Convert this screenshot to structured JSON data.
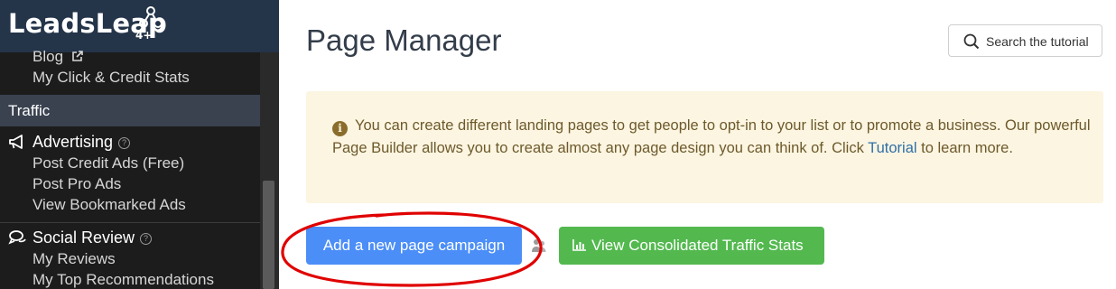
{
  "sidebar": {
    "brand": {
      "name": "LeadsLeap",
      "badge": "4+"
    },
    "top_links": [
      "Blog",
      "My Click & Credit Stats"
    ],
    "section_title": "Traffic",
    "groups": [
      {
        "title": "Advertising",
        "icon": "megaphone-icon",
        "items": [
          "Post Credit Ads (Free)",
          "Post Pro Ads",
          "View Bookmarked Ads"
        ]
      },
      {
        "title": "Social Review",
        "icon": "chat-bubbles-icon",
        "items": [
          "My Reviews",
          "My Top Recommendations"
        ]
      }
    ],
    "help_glyph": "?"
  },
  "main": {
    "title": "Page Manager",
    "tutorial_button": "Search the tutorial",
    "alert": {
      "icon_glyph": "i",
      "text_before": "You can create different landing pages to get people to opt-in to your list or to promote a business. Our powerful Page Builder allows you to create almost any page design you can think of. Click ",
      "link": "Tutorial",
      "text_after": " to learn more."
    },
    "buttons": {
      "add_campaign": "Add a new page campaign",
      "view_stats": "View Consolidated Traffic Stats"
    }
  },
  "colors": {
    "sidebar_bg": "#1c1c1c",
    "brand_bg": "#243449",
    "section_bg": "#3a4250",
    "primary_button": "#4b8ef7",
    "success_button": "#53b94f",
    "alert_bg": "#fcf5e1",
    "annotation": "#e00000"
  }
}
